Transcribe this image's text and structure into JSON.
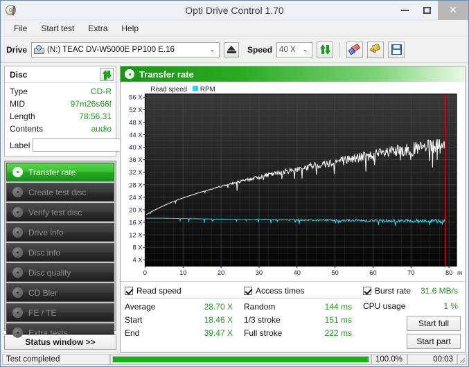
{
  "window": {
    "title": "Opti Drive Control 1.70",
    "app_icon": "cd-pen-icon",
    "minimize": "–",
    "maximize": "□",
    "close": "✕"
  },
  "menu": {
    "items": [
      "File",
      "Start test",
      "Extra",
      "Help"
    ]
  },
  "toolbar": {
    "drive_label": "Drive",
    "drive_value": "(N:)  TEAC DV-W5000E PP100 E.16",
    "drive_caret": "⌄",
    "eject_title": "Eject",
    "speed_label": "Speed",
    "speed_value": "40 X",
    "speed_caret": "⌄",
    "icons": [
      "refresh-icon",
      "eraser-icon",
      "plug-icon",
      "save-icon"
    ]
  },
  "disc_panel": {
    "title": "Disc",
    "refresh_icon": "refresh-icon",
    "rows": [
      {
        "key": "Type",
        "value": "CD-R"
      },
      {
        "key": "MID",
        "value": "97m26s66f"
      },
      {
        "key": "Length",
        "value": "78:56.31"
      },
      {
        "key": "Contents",
        "value": "audio"
      }
    ],
    "label_key": "Label",
    "label_value": "",
    "label_placeholder": "",
    "cd_button_icon": "cd-icon"
  },
  "sidebar": {
    "items": [
      {
        "label": "Transfer rate",
        "icon": "disc-test-icon",
        "active": true
      },
      {
        "label": "Create test disc",
        "icon": "disc-test-icon",
        "active": false
      },
      {
        "label": "Verify test disc",
        "icon": "disc-test-icon",
        "active": false
      },
      {
        "label": "Drive info",
        "icon": "disc-test-icon",
        "active": false
      },
      {
        "label": "Disc info",
        "icon": "disc-test-icon",
        "active": false
      },
      {
        "label": "Disc quality",
        "icon": "disc-test-icon",
        "active": false
      },
      {
        "label": "CD Bler",
        "icon": "disc-test-icon",
        "active": false
      },
      {
        "label": "FE / TE",
        "icon": "disc-test-icon",
        "active": false
      },
      {
        "label": "Extra tests",
        "icon": "disc-test-icon",
        "active": false
      }
    ],
    "status_window_button": "Status window >>"
  },
  "panel": {
    "title": "Transfer rate",
    "icon": "disc-test-icon"
  },
  "chart_data": {
    "type": "line",
    "title": "Transfer rate",
    "xlabel": "min",
    "ylabel": "X",
    "xlim": [
      0,
      82
    ],
    "ylim": [
      2,
      57
    ],
    "xticks": [
      0,
      10,
      20,
      30,
      40,
      50,
      60,
      70,
      80
    ],
    "xtick_labels": [
      "0",
      "10",
      "20",
      "30",
      "40",
      "50",
      "60",
      "70",
      "80"
    ],
    "x_axis_unit": "min",
    "yticks": [
      4,
      8,
      12,
      16,
      20,
      24,
      28,
      32,
      36,
      40,
      44,
      48,
      52,
      56
    ],
    "ytick_labels": [
      "4 X",
      "8 X",
      "12 X",
      "16 X",
      "20 X",
      "24 X",
      "28 X",
      "32 X",
      "36 X",
      "40 X",
      "44 X",
      "48 X",
      "52 X",
      "56 X"
    ],
    "grid": true,
    "legend_position": "top-left",
    "background": "#1a1a1a",
    "end_marker_x": 79,
    "end_marker_color": "#ff0000",
    "series": [
      {
        "name": "Read speed",
        "color": "#ffffff",
        "x": [
          0.3,
          2,
          4,
          6,
          8,
          10,
          12,
          14,
          16,
          18,
          20,
          22,
          24,
          26,
          28,
          30,
          32,
          34,
          36,
          38,
          40,
          42,
          44,
          46,
          48,
          50,
          52,
          54,
          56,
          58,
          60,
          62,
          64,
          66,
          68,
          70,
          72,
          74,
          76,
          78,
          79
        ],
        "values": [
          18.46,
          19.6,
          20.8,
          21.9,
          22.9,
          23.8,
          24.6,
          25.4,
          26.1,
          26.8,
          27.5,
          28.1,
          28.7,
          29.3,
          29.9,
          30.4,
          31.0,
          31.5,
          32.0,
          32.5,
          33.0,
          33.5,
          34.0,
          34.4,
          34.9,
          35.3,
          35.8,
          36.2,
          36.6,
          37.0,
          37.4,
          37.8,
          38.2,
          38.6,
          38.9,
          39.3,
          39.6,
          39.9,
          40.2,
          40.4,
          39.47
        ]
      },
      {
        "name": "RPM",
        "color": "#21dcf0",
        "x": [
          0.3,
          5,
          10,
          15,
          20,
          25,
          30,
          35,
          40,
          45,
          50,
          55,
          60,
          65,
          70,
          75,
          79
        ],
        "values": [
          17.3,
          17.3,
          17.2,
          17.1,
          17.0,
          16.9,
          16.9,
          16.8,
          16.8,
          16.7,
          16.7,
          16.6,
          16.6,
          16.5,
          16.5,
          16.4,
          16.4
        ]
      }
    ],
    "legend": [
      {
        "label": "Read speed",
        "color": "#ffffff"
      },
      {
        "label": "RPM",
        "color": "#21dcf0"
      }
    ]
  },
  "results": {
    "read_speed": {
      "title": "Read speed",
      "checked": true,
      "rows": [
        {
          "key": "Average",
          "value": "28.70 X"
        },
        {
          "key": "Start",
          "value": "18.46 X"
        },
        {
          "key": "End",
          "value": "39.47 X"
        }
      ]
    },
    "access_times": {
      "title": "Access times",
      "checked": true,
      "rows": [
        {
          "key": "Random",
          "value": "144 ms"
        },
        {
          "key": "1/3 stroke",
          "value": "151 ms"
        },
        {
          "key": "Full stroke",
          "value": "222 ms"
        }
      ]
    },
    "burst": {
      "title": "Burst rate",
      "checked": true,
      "burst_value": "31.6 MB/s",
      "cpu_key": "CPU usage",
      "cpu_value": "1 %",
      "start_full": "Start full",
      "start_part": "Start part"
    }
  },
  "statusbar": {
    "message": "Test completed",
    "progress_percent": 100.0,
    "progress_label": "100.0%",
    "elapsed": "00:03"
  }
}
